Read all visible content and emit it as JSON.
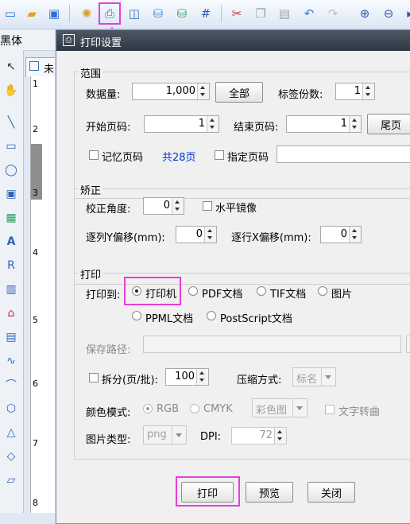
{
  "toolbar": {
    "icons": [
      "new-icon",
      "open-icon",
      "save-icon",
      "settings-icon",
      "print-icon",
      "print-preview-icon",
      "database-icon",
      "data-refresh-icon",
      "grid-icon",
      "cut-icon",
      "copy-icon",
      "paste-icon",
      "undo-icon",
      "redo-icon",
      "zoom-in-icon",
      "zoom-out-icon",
      "fit-icon"
    ]
  },
  "font_label": "黑体",
  "doc_tab_label": "未",
  "ruler_labels": [
    "1",
    "2",
    "3",
    "4",
    "5",
    "6",
    "7",
    "8"
  ],
  "dialog": {
    "title": "打印设置",
    "range": {
      "group_label": "范围",
      "data_count_label": "数据量:",
      "data_count_value": "1,000",
      "all_button": "全部",
      "copies_label": "标签份数:",
      "copies_value": "1",
      "start_page_label": "开始页码:",
      "start_page_value": "1",
      "end_page_label": "结束页码:",
      "end_page_value": "1",
      "last_page_button": "尾页",
      "remember_page_label": "记忆页码",
      "total_pages": "共28页",
      "specify_page_label": "指定页码"
    },
    "correction": {
      "group_label": "矫正",
      "angle_label": "校正角度:",
      "angle_value": "0",
      "mirror_label": "水平镜像",
      "col_offset_label": "逐列Y偏移(mm):",
      "col_offset_value": "0",
      "row_offset_label": "逐行X偏移(mm):",
      "row_offset_value": "0"
    },
    "print": {
      "group_label": "打印",
      "print_to_label": "打印到:",
      "options": [
        "打印机",
        "PDF文档",
        "TIF文档",
        "图片",
        "PPML文档",
        "PostScript文档"
      ],
      "selected_option": "打印机",
      "save_path_label": "保存路径:",
      "split_label": "拆分(页/批):",
      "split_value": "100",
      "compress_label": "压缩方式:",
      "compress_value": "标名",
      "color_mode_label": "颜色模式:",
      "color_rgb": "RGB",
      "color_cmyk": "CMYK",
      "color_combo_value": "彩色图",
      "text_to_curve_label": "文字转曲",
      "image_type_label": "图片类型:",
      "image_type_value": "png",
      "dpi_label": "DPI:",
      "dpi_value": "72"
    },
    "buttons": {
      "print": "打印",
      "preview": "预览",
      "close": "关闭"
    }
  },
  "colors": {
    "highlight": "#e43fd9",
    "title_bar": "#38424e",
    "link_blue": "#0033cc"
  }
}
